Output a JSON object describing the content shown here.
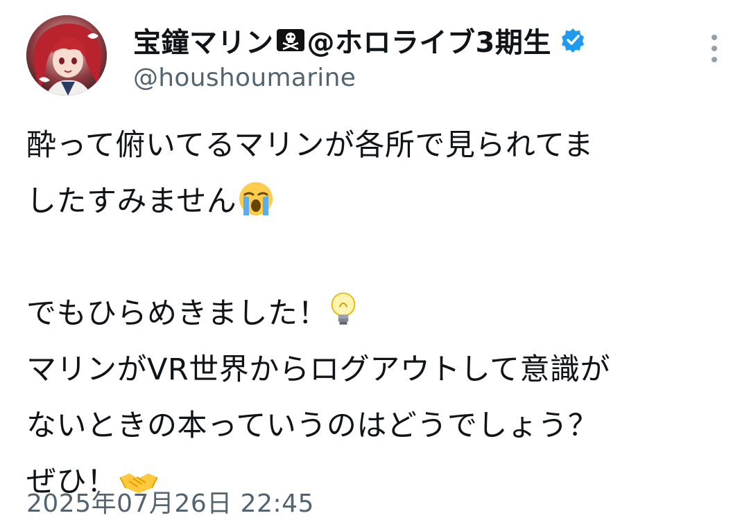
{
  "author": {
    "display_name": "宝鐘マリン",
    "display_name_suffix": "@ホロライブ3期生",
    "name_emoji": "pirate-flag-icon",
    "verified_icon": "verified-badge-icon",
    "handle": "@houshoumarine",
    "avatar": "avatar-image"
  },
  "menu_icon": "more-options-icon",
  "tweet": {
    "lines": [
      "酔って俯いてるマリンが各所で見られてま",
      "したすみません",
      "",
      "でもひらめきました！",
      "マリンがVR世界からログアウトして意識が",
      "ないときの本っていうのはどうでしょう？",
      "ぜひ！"
    ],
    "emojis": {
      "crying": "loudly-crying-face-emoji",
      "bulb": "light-bulb-emoji",
      "handshake": "handshake-emoji"
    },
    "timestamp": "2025年07月26日 22:45"
  },
  "colors": {
    "text": "#0f1419",
    "secondary": "#536471",
    "verified": "#1d9bf0"
  }
}
